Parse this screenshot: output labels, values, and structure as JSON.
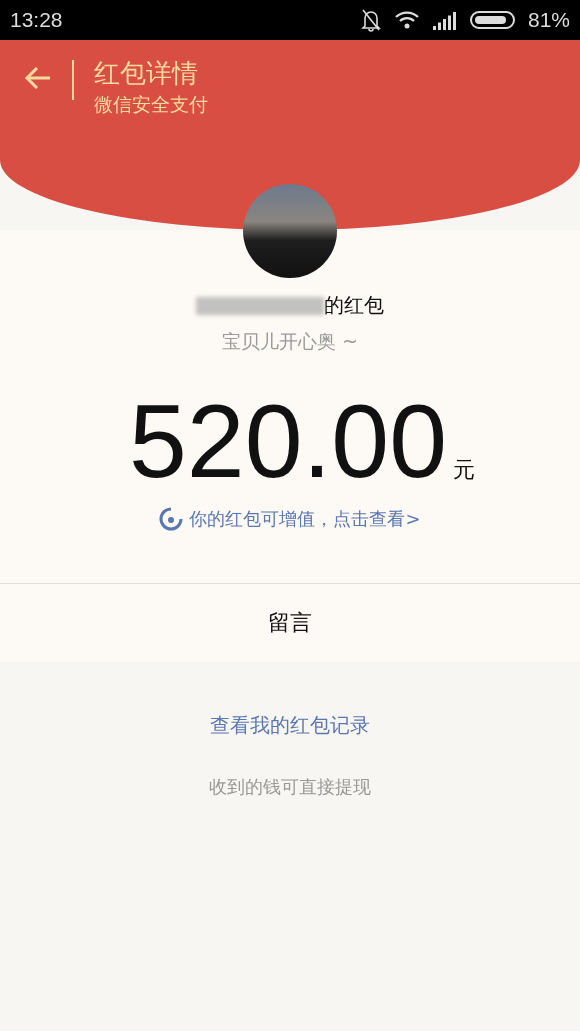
{
  "status_bar": {
    "time": "13:28",
    "battery": "81%"
  },
  "header": {
    "title": "红包详情",
    "subtitle": "微信安全支付"
  },
  "sender": {
    "name_suffix": "的红包",
    "greeting": "宝贝儿开心奥 ~"
  },
  "amount": {
    "value": "520.00",
    "unit": "元"
  },
  "promo_link": "你的红包可增值，点击查看>",
  "message_row": "留言",
  "records_link": "查看我的红包记录",
  "note": "收到的钱可直接提现"
}
